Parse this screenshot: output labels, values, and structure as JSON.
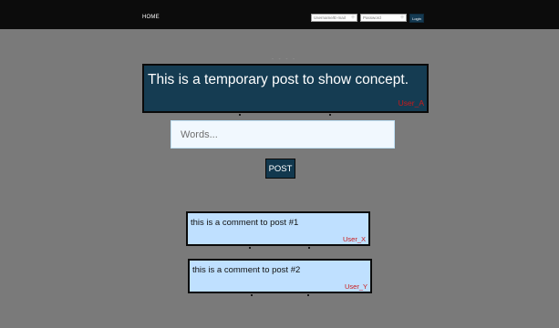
{
  "nav": {
    "home_label": "HOME",
    "username_placeholder": "Username/E-mail",
    "password_placeholder": "Password",
    "login_label": "Login",
    "field_icon": "key-icon"
  },
  "separator": "- - - -",
  "post": {
    "text": "This is a temporary post to show concept.",
    "user": "User_A"
  },
  "composer": {
    "placeholder": "Words...",
    "post_label": "POST"
  },
  "comments": [
    {
      "text": "this is a comment to post #1",
      "user": "User_X"
    },
    {
      "text": "this is a comment to post #2",
      "user": "User_Y"
    }
  ],
  "colors": {
    "background": "#7a7a7a",
    "topbar": "#0c0c0c",
    "post_card": "#153c52",
    "comment_card": "#bfe0ff",
    "username_red": "#cc1a1a"
  }
}
